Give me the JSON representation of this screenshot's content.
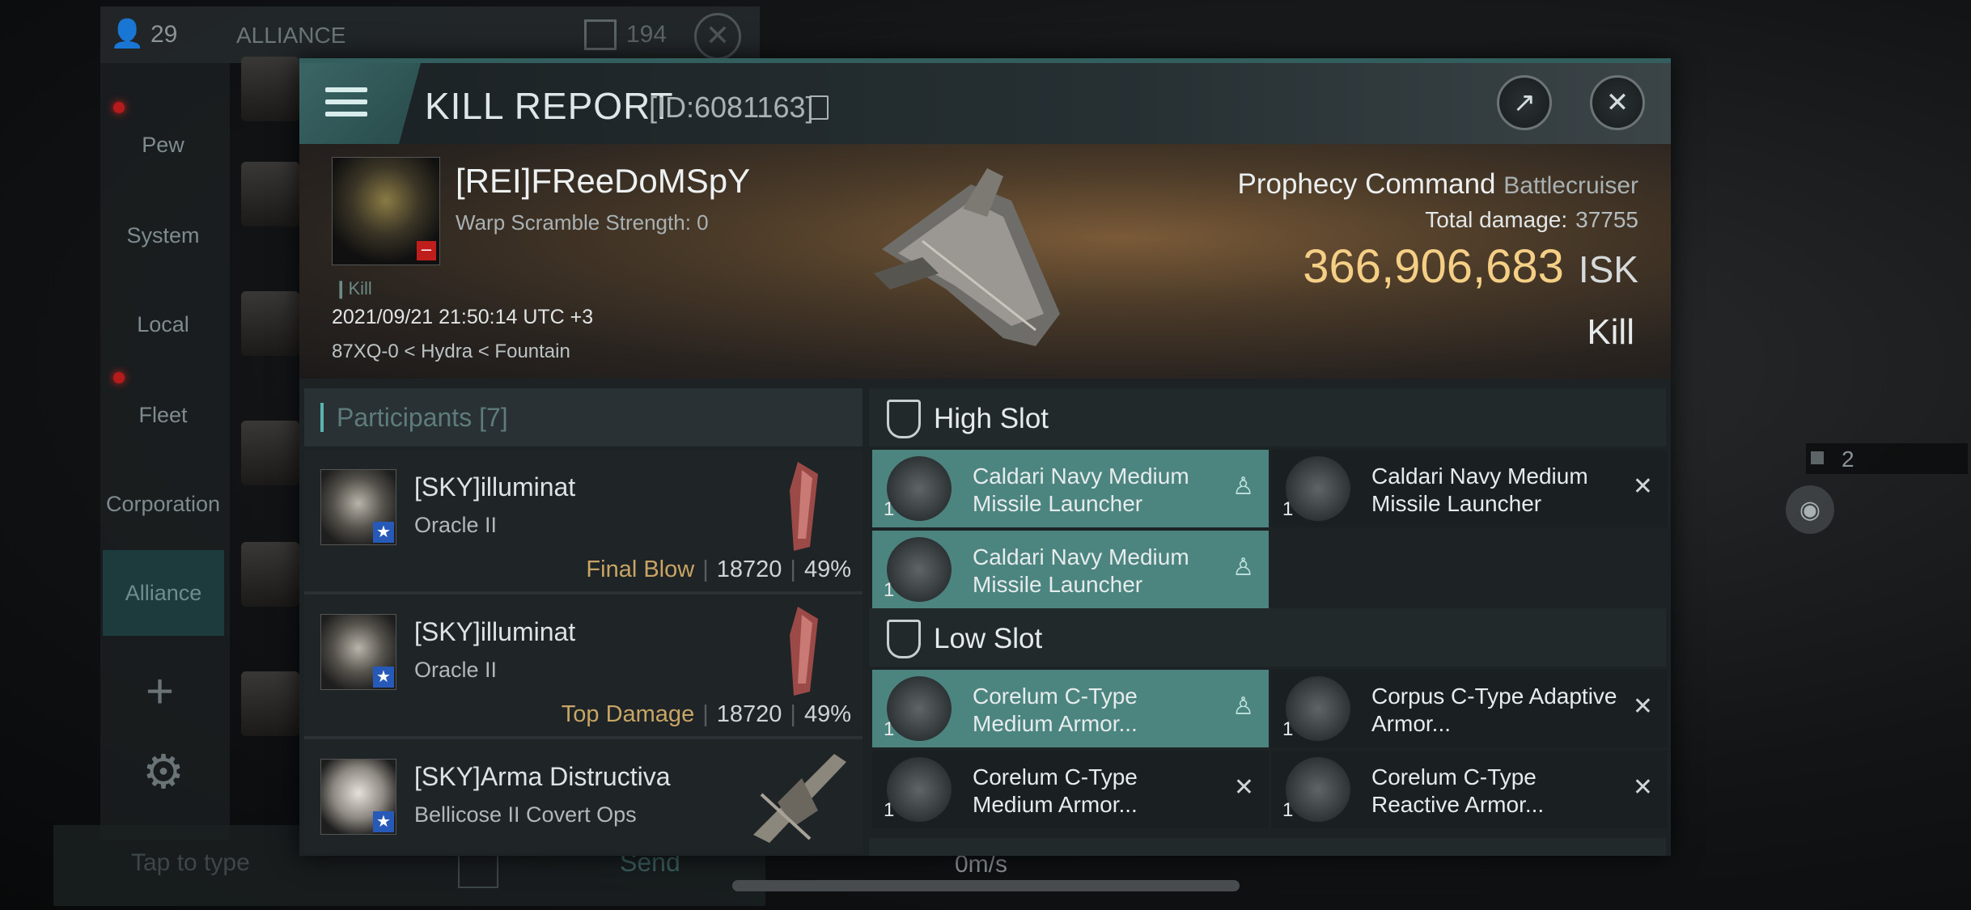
{
  "background": {
    "online_count": "29",
    "channel_title": "ALLIANCE",
    "member_count": "194",
    "sidebar": [
      "Pew",
      "System",
      "Local",
      "Fleet",
      "Corporation",
      "Alliance"
    ],
    "input_placeholder": "Tap to type",
    "send_label": "Send",
    "speed": "0m/s",
    "right_badge_count": "2"
  },
  "modal": {
    "title": "KILL REPORT",
    "id_label": "[ID:6081163]",
    "victim": {
      "name": "[REI]FReeDoMSpY",
      "sub": "Warp Scramble Strength: 0",
      "tag": "Kill",
      "time": "2021/09/21 21:50:14 UTC +3",
      "location": "87XQ-0 < Hydra < Fountain"
    },
    "ship": {
      "name": "Prophecy Command",
      "class": "Battlecruiser",
      "damage_label": "Total damage:",
      "damage_value": "37755",
      "isk_value": "366,906,683",
      "isk_unit": "ISK",
      "result": "Kill"
    },
    "participants": {
      "title": "Participants",
      "count": "[7]",
      "rows": [
        {
          "name": "[SKY]illuminat",
          "ship": "Oracle II",
          "tag": "Final Blow",
          "damage": "18720",
          "percent": "49%"
        },
        {
          "name": "[SKY]illuminat",
          "ship": "Oracle II",
          "tag": "Top Damage",
          "damage": "18720",
          "percent": "49%"
        },
        {
          "name": "[SKY]Arma Distructiva",
          "ship": "Bellicose II Covert Ops",
          "tag": "",
          "damage": "",
          "percent": ""
        }
      ]
    },
    "high_slot": {
      "title": "High Slot",
      "modules": [
        {
          "name": "Caldari Navy Medium Missile Launcher",
          "qty": "1",
          "status": "dropped"
        },
        {
          "name": "Caldari Navy Medium Missile Launcher",
          "qty": "1",
          "status": "destroyed"
        },
        {
          "name": "Caldari Navy Medium Missile Launcher",
          "qty": "1",
          "status": "dropped"
        }
      ]
    },
    "low_slot": {
      "title": "Low Slot",
      "modules": [
        {
          "name": "Corelum C-Type Medium Armor...",
          "qty": "1",
          "status": "dropped"
        },
        {
          "name": "Corpus C-Type Adaptive Armor...",
          "qty": "1",
          "status": "destroyed"
        },
        {
          "name": "Corelum C-Type Medium Armor...",
          "qty": "1",
          "status": "destroyed"
        },
        {
          "name": "Corelum C-Type Reactive Armor...",
          "qty": "1",
          "status": "destroyed"
        }
      ]
    }
  },
  "icons": {
    "dropped": "person-icon",
    "destroyed": "close-icon"
  },
  "colors": {
    "accent": "#4c8580",
    "isk": "#f4cf85",
    "tag": "#c8a565"
  }
}
